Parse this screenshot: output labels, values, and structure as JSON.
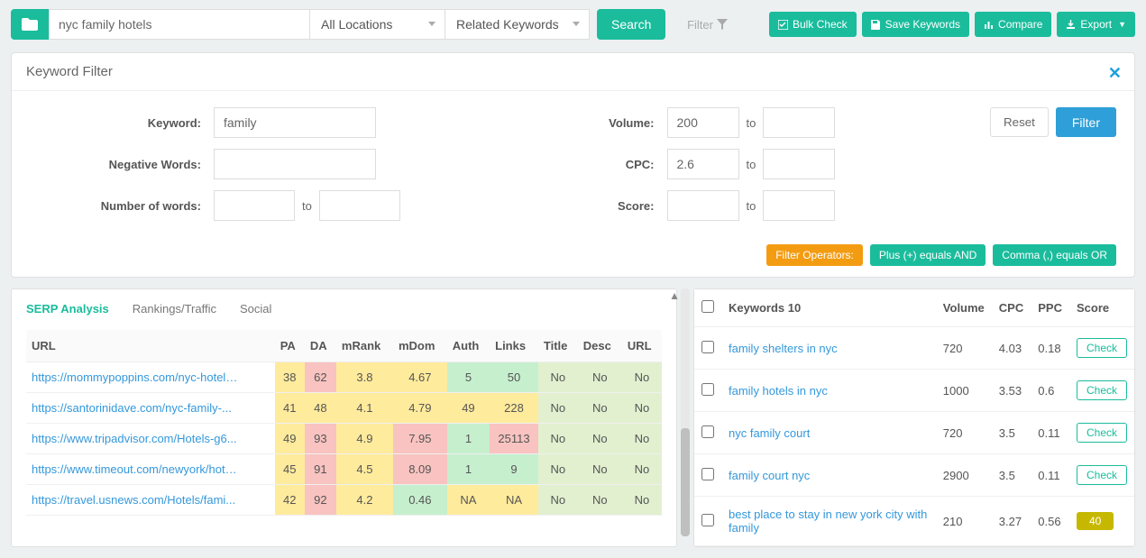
{
  "top": {
    "search_value": "nyc family hotels",
    "loc_select": "All Locations",
    "type_select": "Related Keywords",
    "search_btn": "Search",
    "filter_label": "Filter",
    "bulk": "Bulk Check",
    "save": "Save Keywords",
    "compare": "Compare",
    "export": "Export"
  },
  "panel": {
    "title": "Keyword Filter",
    "labels": {
      "keyword": "Keyword:",
      "negative": "Negative Words:",
      "numwords": "Number of words:",
      "volume": "Volume:",
      "cpc": "CPC:",
      "score": "Score:",
      "to": "to"
    },
    "keyword_value": "family",
    "volume_from": "200",
    "cpc_from": "2.6",
    "reset": "Reset",
    "filter": "Filter",
    "op_label": "Filter Operators:",
    "op_plus": "Plus (+) equals AND",
    "op_comma": "Comma (,) equals OR"
  },
  "serp": {
    "tabs": [
      "SERP Analysis",
      "Rankings/Traffic",
      "Social"
    ],
    "headers": [
      "URL",
      "PA",
      "DA",
      "mRank",
      "mDom",
      "Auth",
      "Links",
      "Title",
      "Desc",
      "URL"
    ],
    "rows": [
      {
        "url": "https://mommypoppins.com/nyc-hotel-fa...",
        "pa": "38",
        "da": "62",
        "mrank": "3.8",
        "mdom": "4.67",
        "auth": "5",
        "links": "50",
        "title": "No",
        "desc": "No",
        "urlc": "No",
        "cls": {
          "pa": "c-yellow",
          "da": "c-pink",
          "mrank": "c-yellow",
          "mdom": "c-yellow",
          "auth": "c-green",
          "links": "c-green",
          "no": "c-light"
        }
      },
      {
        "url": "https://santorinidave.com/nyc-family-...",
        "pa": "41",
        "da": "48",
        "mrank": "4.1",
        "mdom": "4.79",
        "auth": "49",
        "links": "228",
        "title": "No",
        "desc": "No",
        "urlc": "No",
        "cls": {
          "pa": "c-yellow",
          "da": "c-yellow",
          "mrank": "c-yellow",
          "mdom": "c-yellow",
          "auth": "c-yellow",
          "links": "c-yellow",
          "no": "c-light"
        }
      },
      {
        "url": "https://www.tripadvisor.com/Hotels-g6...",
        "pa": "49",
        "da": "93",
        "mrank": "4.9",
        "mdom": "7.95",
        "auth": "1",
        "links": "25113",
        "title": "No",
        "desc": "No",
        "urlc": "No",
        "cls": {
          "pa": "c-yellow",
          "da": "c-pink",
          "mrank": "c-yellow",
          "mdom": "c-pink",
          "auth": "c-green",
          "links": "c-pink",
          "no": "c-light"
        }
      },
      {
        "url": "https://www.timeout.com/newyork/hotel...",
        "pa": "45",
        "da": "91",
        "mrank": "4.5",
        "mdom": "8.09",
        "auth": "1",
        "links": "9",
        "title": "No",
        "desc": "No",
        "urlc": "No",
        "cls": {
          "pa": "c-yellow",
          "da": "c-pink",
          "mrank": "c-yellow",
          "mdom": "c-pink",
          "auth": "c-green",
          "links": "c-green",
          "no": "c-light"
        }
      },
      {
        "url": "https://travel.usnews.com/Hotels/fami...",
        "pa": "42",
        "da": "92",
        "mrank": "4.2",
        "mdom": "0.46",
        "auth": "NA",
        "links": "NA",
        "title": "No",
        "desc": "No",
        "urlc": "No",
        "cls": {
          "pa": "c-yellow",
          "da": "c-pink",
          "mrank": "c-yellow",
          "mdom": "c-green",
          "auth": "c-yellow",
          "links": "c-yellow",
          "no": "c-light"
        }
      }
    ]
  },
  "kw": {
    "header_kw": "Keywords 10",
    "header_vol": "Volume",
    "header_cpc": "CPC",
    "header_ppc": "PPC",
    "header_score": "Score",
    "check": "Check",
    "rows": [
      {
        "kw": "family shelters in nyc",
        "vol": "720",
        "cpc": "4.03",
        "ppc": "0.18",
        "score": "",
        "badge": false
      },
      {
        "kw": "family hotels in nyc",
        "vol": "1000",
        "cpc": "3.53",
        "ppc": "0.6",
        "score": "",
        "badge": false
      },
      {
        "kw": "nyc family court",
        "vol": "720",
        "cpc": "3.5",
        "ppc": "0.11",
        "score": "",
        "badge": false
      },
      {
        "kw": "family court nyc",
        "vol": "2900",
        "cpc": "3.5",
        "ppc": "0.11",
        "score": "",
        "badge": false
      },
      {
        "kw": "best place to stay in new york city with family",
        "vol": "210",
        "cpc": "3.27",
        "ppc": "0.56",
        "score": "40",
        "badge": true
      }
    ]
  }
}
